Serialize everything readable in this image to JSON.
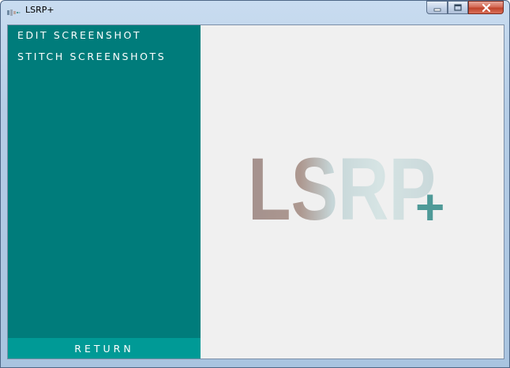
{
  "window": {
    "title": "LSRP+",
    "controls": {
      "minimize": "‒",
      "maximize": "□",
      "close": "✕"
    }
  },
  "sidebar": {
    "items": [
      {
        "label": "EDIT SCREENSHOT"
      },
      {
        "label": "STITCH SCREENSHOTS"
      }
    ],
    "return_label": "RETURN"
  },
  "logo": {
    "text": "LSRP",
    "plus": "+"
  },
  "colors": {
    "sidebar": "#007c7b",
    "return_button": "#009a96",
    "main_bg": "#f0f0f0",
    "logo_plus": "#4f9a98"
  }
}
